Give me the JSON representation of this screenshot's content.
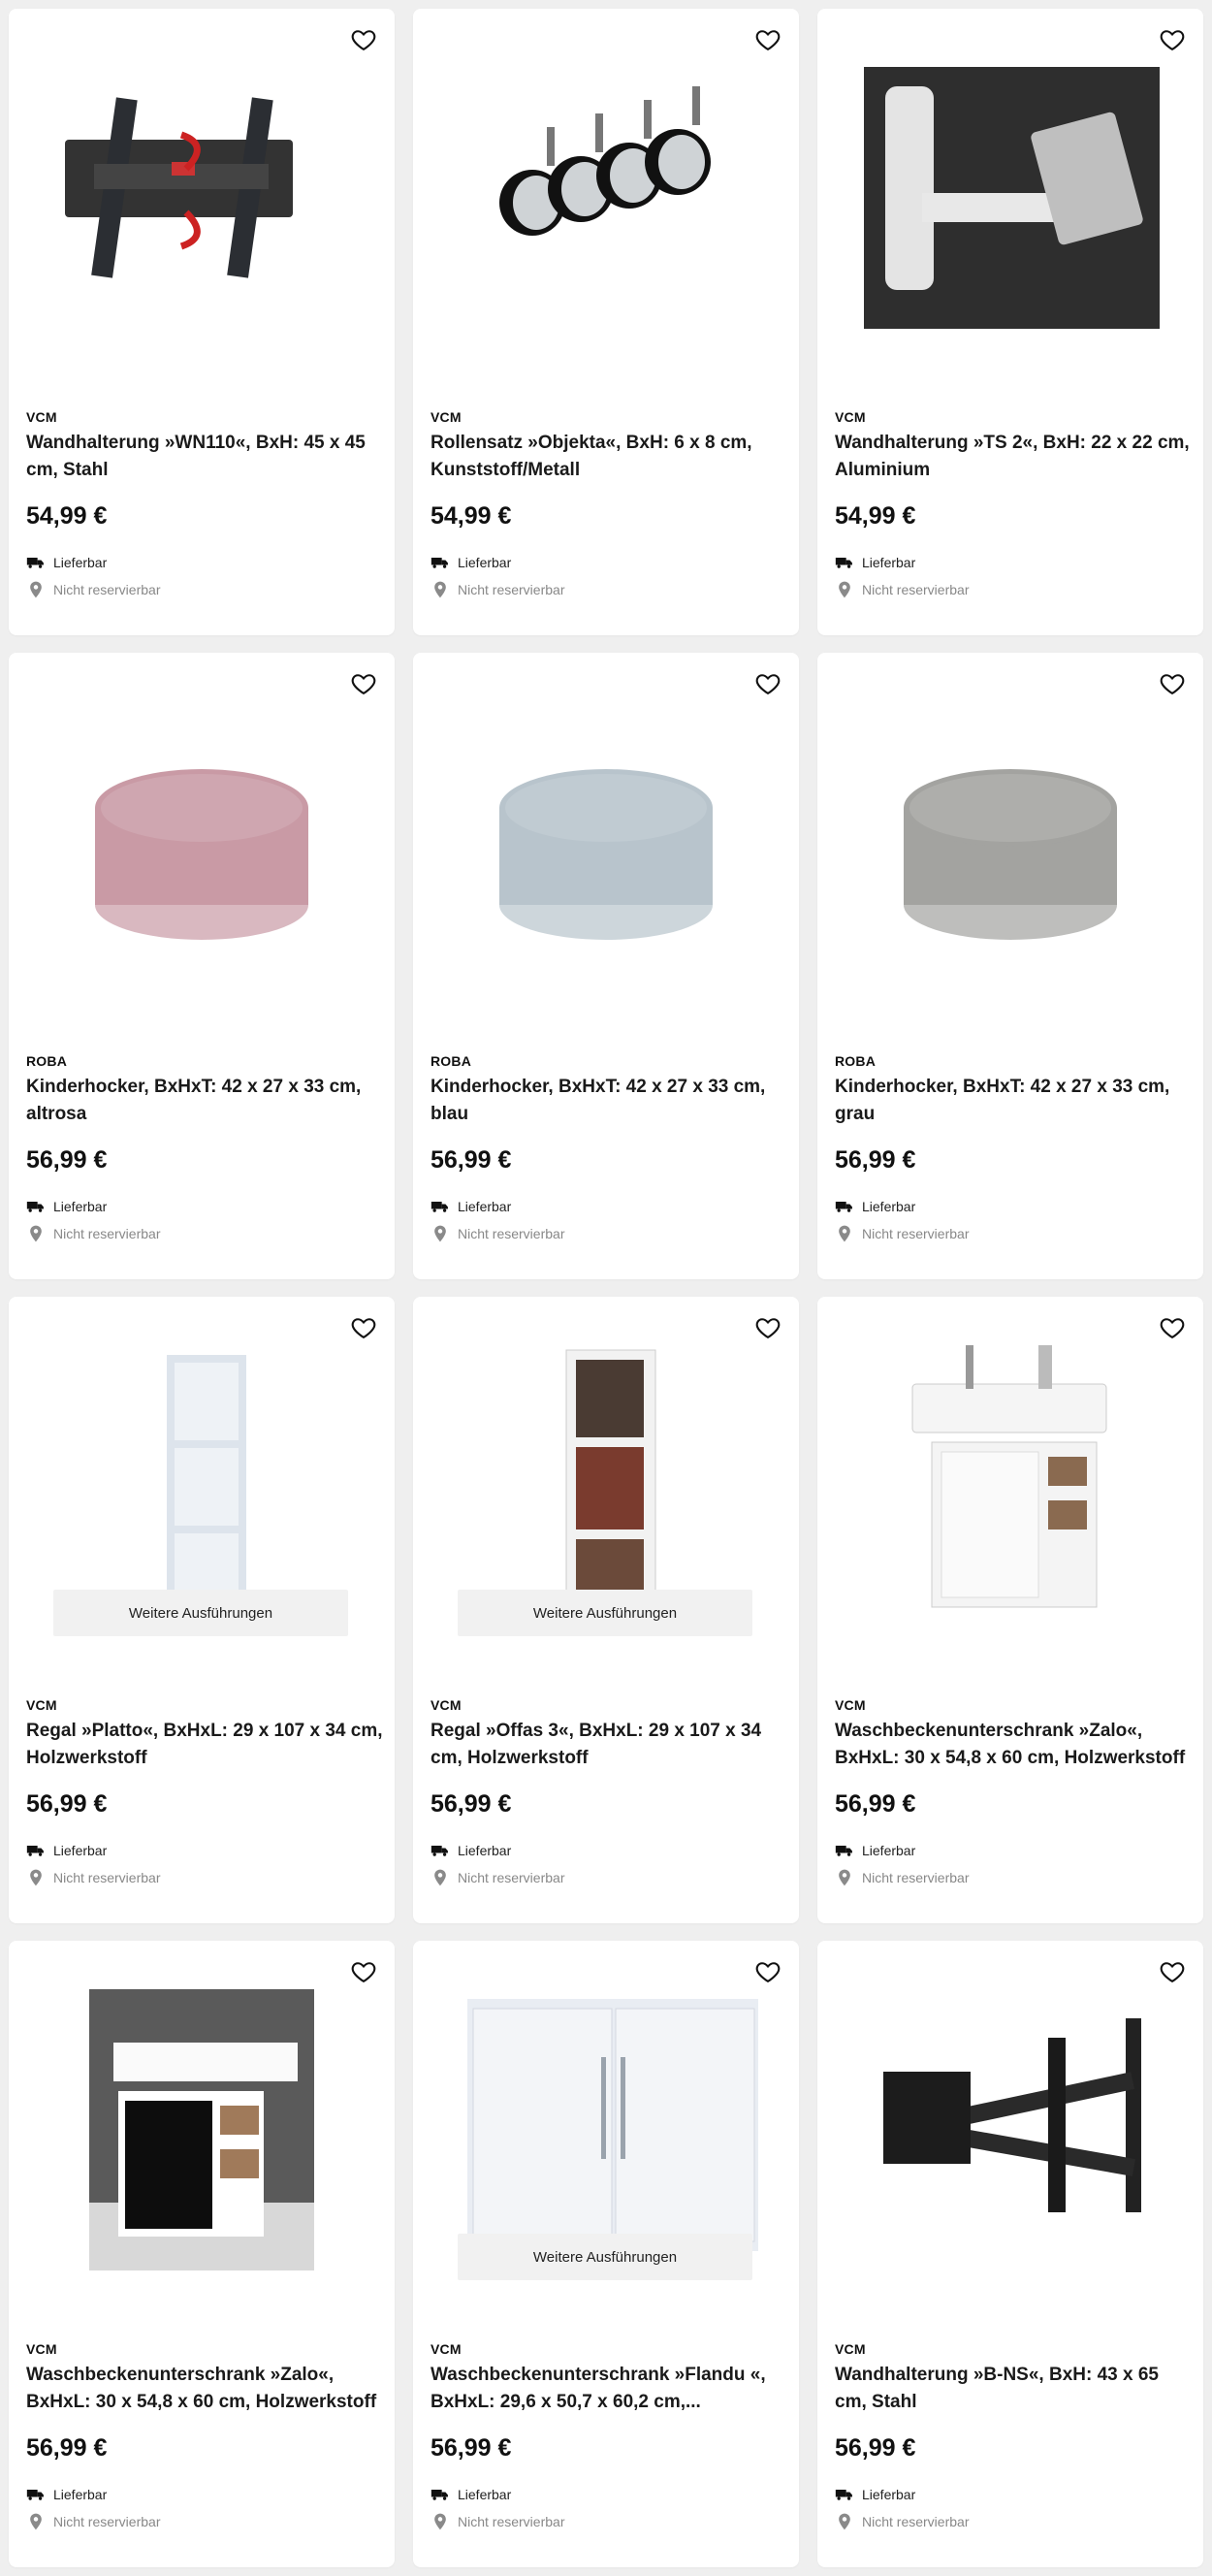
{
  "labels": {
    "delivery": "Lieferbar",
    "reservation": "Nicht reservierbar",
    "more_variants": "Weitere Ausführungen"
  },
  "products": [
    {
      "brand": "VCM",
      "title": "Wandhalterung »WN110«, BxH: 45 x 45 cm, Stahl",
      "price": "54,99 €",
      "image": "tv-mount-tilt"
    },
    {
      "brand": "VCM",
      "title": "Rollensatz »Objekta«, BxH: 6 x 8 cm, Kunststoff/Metall",
      "price": "54,99 €",
      "image": "caster-wheels"
    },
    {
      "brand": "VCM",
      "title": "Wandhalterung »TS 2«, BxH: 22 x 22 cm, Aluminium",
      "price": "54,99 €",
      "image": "tv-mount-arm"
    },
    {
      "brand": "ROBA",
      "title": "Kinderhocker, BxHxT: 42 x 27 x 33 cm, altrosa",
      "price": "56,99 €",
      "image": "pouf",
      "color": "#c99aa5"
    },
    {
      "brand": "ROBA",
      "title": "Kinderhocker, BxHxT: 42 x 27 x 33 cm, blau",
      "price": "56,99 €",
      "image": "pouf",
      "color": "#b8c4cc"
    },
    {
      "brand": "ROBA",
      "title": "Kinderhocker, BxHxT: 42 x 27 x 33 cm, grau",
      "price": "56,99 €",
      "image": "pouf",
      "color": "#a3a3a0"
    },
    {
      "brand": "VCM",
      "title": "Regal »Platto«, BxHxL: 29 x 107 x 34 cm, Holzwerkstoff",
      "price": "56,99 €",
      "image": "shelf-empty",
      "more": true
    },
    {
      "brand": "VCM",
      "title": "Regal »Offas 3«, BxHxL: 29 x 107 x 34 cm, Holzwerkstoff",
      "price": "56,99 €",
      "image": "shelf-books",
      "more": true
    },
    {
      "brand": "VCM",
      "title": "Waschbeckenunterschrank »Zalo«, BxHxL: 30 x 54,8 x 60 cm, Holzwerkstoff",
      "price": "56,99 €",
      "image": "vanity-white"
    },
    {
      "brand": "VCM",
      "title": "Waschbeckenunterschrank »Zalo«, BxHxL: 30 x 54,8 x 60 cm, Holzwerkstoff",
      "price": "56,99 €",
      "image": "vanity-black"
    },
    {
      "brand": "VCM",
      "title": "Waschbeckenunterschrank »Flandu «, BxHxL: 29,6 x 50,7 x 60,2 cm,...",
      "price": "56,99 €",
      "image": "vanity-doors",
      "more": true
    },
    {
      "brand": "VCM",
      "title": "Wandhalterung »B-NS«, BxH: 43 x 65 cm, Stahl",
      "price": "56,99 €",
      "image": "tv-mount-large"
    }
  ]
}
